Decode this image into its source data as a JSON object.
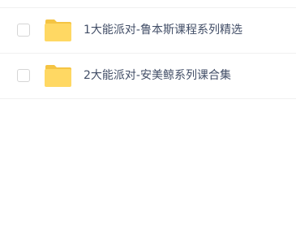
{
  "files": [
    {
      "name": "1大能派对-鲁本斯课程系列精选",
      "type": "folder-icon",
      "checked": false
    },
    {
      "name": "2大能派对-安美鲸系列课合集",
      "type": "folder-icon",
      "checked": false
    }
  ],
  "colors": {
    "folder_body": "#FFD863",
    "folder_tab": "#F5C443",
    "text": "#424E67",
    "divider": "#F0F0F0",
    "checkbox_border": "#D5D5D5"
  }
}
